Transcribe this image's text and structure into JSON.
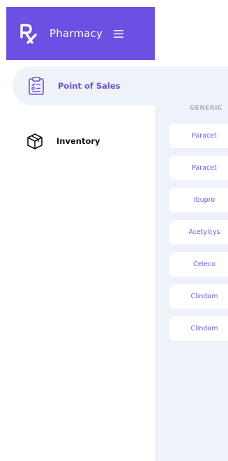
{
  "brand": {
    "logo": "rx-icon",
    "name": "Pharmacy",
    "menu_icon": "hamburger-menu-icon",
    "color": "#6c4fe3"
  },
  "nav": {
    "items": [
      {
        "label": "Point of Sales",
        "icon": "clipboard-list-icon",
        "active": true
      },
      {
        "label": "Inventory",
        "icon": "box-icon",
        "active": false
      }
    ]
  },
  "table": {
    "column_header": "GENERIC",
    "rows": [
      "Paracet",
      "Paracet",
      "Ibupro",
      "Acetylcys",
      "Celeco",
      "Clindam",
      "Clindam"
    ]
  },
  "colors": {
    "accent": "#6c4fe3",
    "panel_bg": "#eef2f9",
    "row_text": "#6b5ee0",
    "header_text": "#a9b0bd"
  }
}
